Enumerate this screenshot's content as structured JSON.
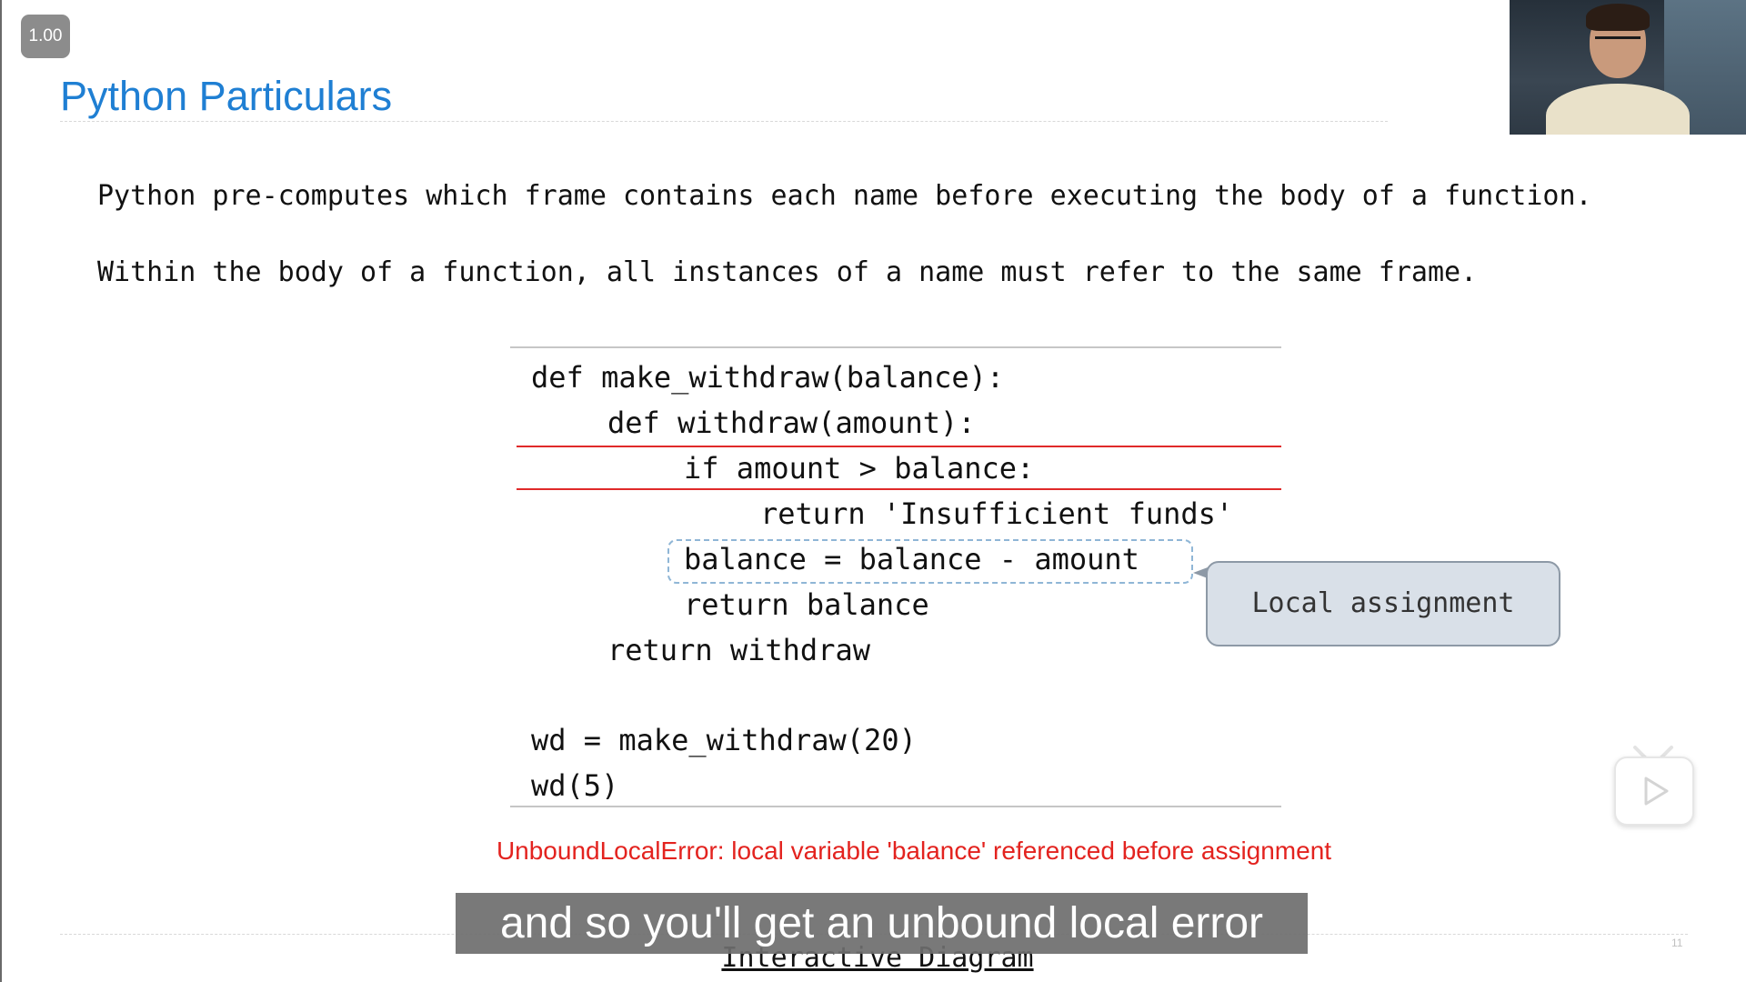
{
  "player": {
    "speed_label": "1.00",
    "subtitle": "and so you'll get an unbound local error",
    "play_icon": "play-icon"
  },
  "slide": {
    "title": "Python Particulars",
    "paragraphs": [
      "Python pre-computes which frame contains each name before executing the body of a function.",
      "Within the body of a function, all instances of a name must refer to the same frame."
    ],
    "code_lines": [
      "def make_withdraw(balance):",
      "def withdraw(amount):",
      "if amount > balance:",
      "return 'Insufficient funds'",
      "balance = balance - amount",
      "return balance",
      "return withdraw",
      "wd = make_withdraw(20)",
      "wd(5)"
    ],
    "callout": "Local assignment",
    "error": "UnboundLocalError: local variable 'balance' referenced before assignment",
    "link": "Interactive Diagram",
    "page_number": "11"
  },
  "colors": {
    "title": "#1f7fd3",
    "error": "#e3231f",
    "highlight_rule": "#e02a2a",
    "callout_bg": "#d9e0e8"
  }
}
